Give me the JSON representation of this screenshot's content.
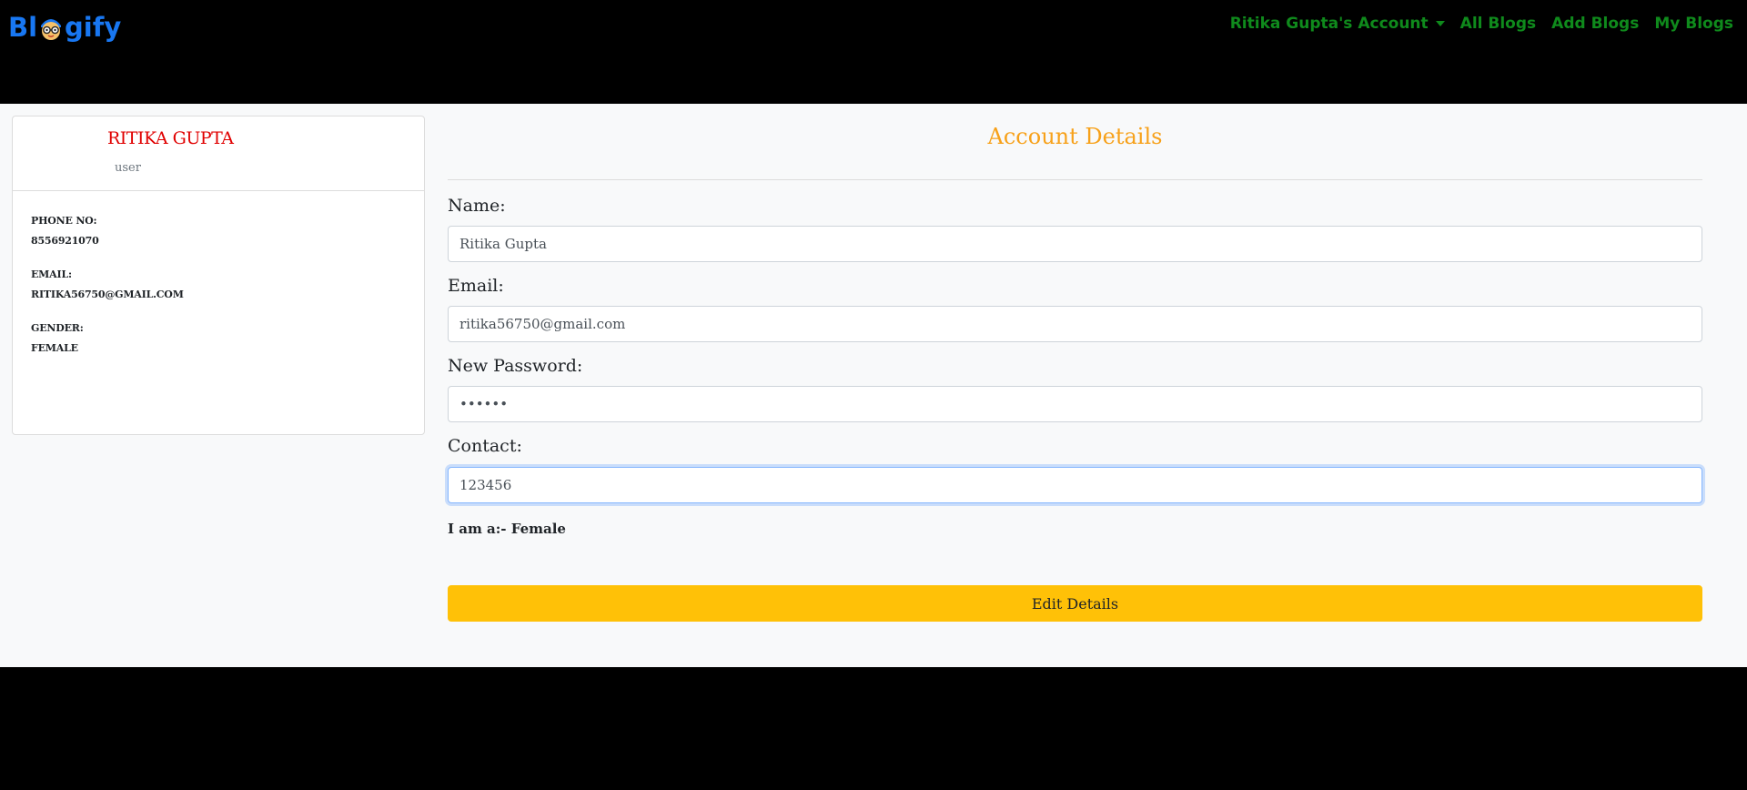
{
  "brand": {
    "part1": "Bl",
    "part2": "gify"
  },
  "nav": {
    "account_label": "Ritika Gupta's Account",
    "links": [
      "All Blogs",
      "Add Blogs",
      "My Blogs"
    ]
  },
  "profile": {
    "name": "RITIKA GUPTA",
    "role": "user",
    "fields": [
      {
        "label": "PHONE NO:",
        "value": "8556921070"
      },
      {
        "label": "EMAIL:",
        "value": "RITIKA56750@GMAIL.COM"
      },
      {
        "label": "GENDER:",
        "value": "FEMALE"
      }
    ]
  },
  "account": {
    "title": "Account Details",
    "name_label": "Name:",
    "name_value": "Ritika Gupta",
    "email_label": "Email:",
    "email_value": "ritika56750@gmail.com",
    "password_label": "New Password:",
    "password_value": "••••••",
    "contact_label": "Contact:",
    "contact_value": "123456",
    "gender_line": "I am a:- Female",
    "edit_button": "Edit Details"
  },
  "colors": {
    "brand": "#1877f2",
    "nav_link": "#0f8a1c",
    "profile_name": "#e00000",
    "title": "#f7a11a",
    "button": "#ffc107"
  }
}
